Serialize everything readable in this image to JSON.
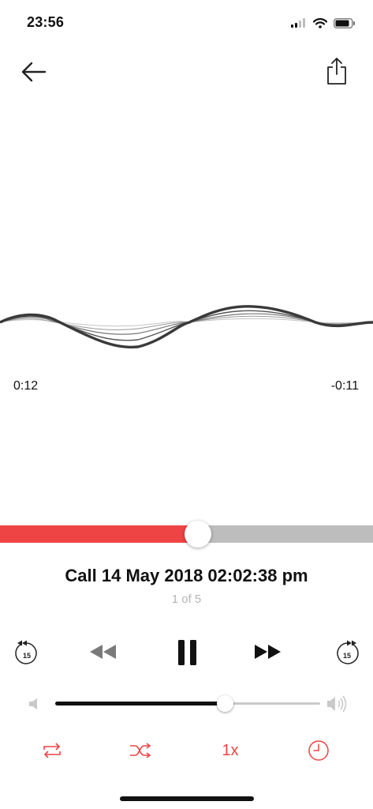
{
  "status_bar": {
    "time": "23:56"
  },
  "player": {
    "elapsed": "0:12",
    "remaining": "-0:11",
    "progress": 0.53,
    "title": "Call 14 May 2018 02:02:38 pm",
    "track_position": "1 of 5",
    "skip_back_seconds": "15",
    "skip_forward_seconds": "15",
    "speed": "1x",
    "volume": 0.64
  },
  "icons": {
    "back": "arrow-left-icon",
    "share": "share-icon",
    "rewind": "rewind-icon",
    "pause": "pause-icon",
    "forward": "fast-forward-icon",
    "repeat": "repeat-icon",
    "shuffle": "shuffle-icon",
    "sleep_timer": "clock-icon"
  },
  "colors": {
    "accent": "#ef4444",
    "track": "#bdbdbd",
    "text": "#111111",
    "muted": "#b5b5b5"
  }
}
